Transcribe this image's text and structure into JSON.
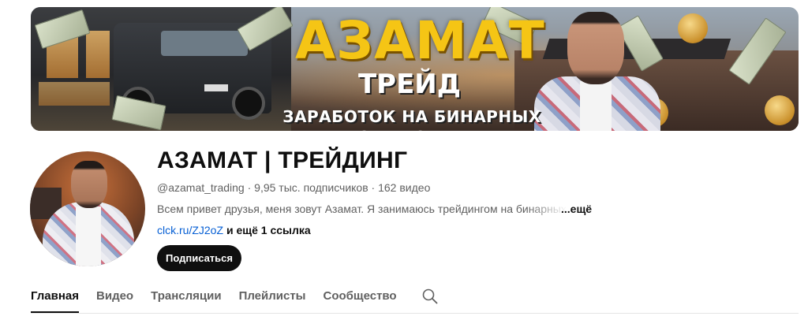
{
  "banner": {
    "title": "АЗАМАТ",
    "subtitle": "ТРЕЙД",
    "tagline": "ЗАРАБОТОК НА БИНАРНЫХ ОПЦИОНАХ",
    "plate_text": "",
    "colors": {
      "title": "#f5c515",
      "text": "#ffffff"
    }
  },
  "channel": {
    "name": "АЗАМАТ | ТРЕЙДИНГ",
    "handle": "@azamat_trading",
    "separator": " · ",
    "subscribers": "9,95 тыс. подписчиков",
    "videos": "162 видео",
    "description": "Всем привет друзья, меня зовут Азамат. Я занимаюсь трейдингом на бинарных опционах",
    "more_label": "...ещё",
    "link_text": "clck.ru/ZJ2oZ",
    "extra_links": "и ещё 1 ссылка",
    "subscribe_label": "Подписаться"
  },
  "tabs": [
    {
      "label": "Главная",
      "active": true
    },
    {
      "label": "Видео",
      "active": false
    },
    {
      "label": "Трансляции",
      "active": false
    },
    {
      "label": "Плейлисты",
      "active": false
    },
    {
      "label": "Сообщество",
      "active": false
    }
  ],
  "icons": {
    "search": "search-icon"
  },
  "colors": {
    "link": "#065fd4",
    "button_bg": "#0f0f0f",
    "muted_text": "#606060"
  }
}
